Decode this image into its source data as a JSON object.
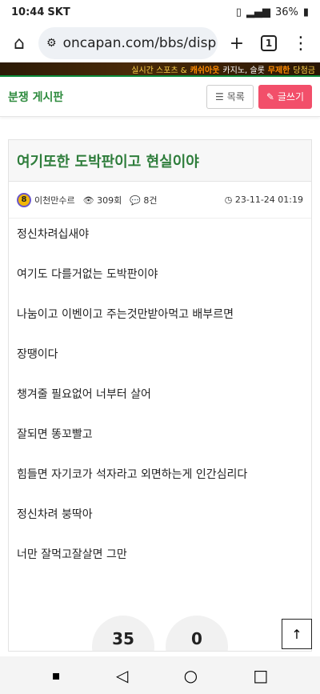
{
  "status": {
    "time": "10:44",
    "carrier": "SKT",
    "battery": "36%"
  },
  "browser": {
    "url": "oncapan.com/bbs/disp",
    "tab_count": "1"
  },
  "banner": {
    "prefix": "실시간 스포츠 &",
    "casino": "캐쉬아웃",
    "middle": "카지노, 슬롯",
    "unlimited": "무제한",
    "suffix": "당첨금"
  },
  "board": {
    "title": "분쟁 게시판",
    "list_label": "목록",
    "write_label": "글쓰기"
  },
  "post": {
    "title": "여기또한 도박판이고 현실이야",
    "author_level": "8",
    "author": "이천만수르",
    "views": "309회",
    "comments": "8건",
    "date": "23-11-24 01:19",
    "lines": [
      "정신차려십새야",
      "여기도 다를거없는 도박판이야",
      "나눔이고 이벤이고 주는것만받아먹고 배부르면",
      "장땡이다",
      "챙겨줄 필요없어 너부터 살어",
      "잘되면 똥꼬빨고",
      "힘들면 자기코가 석자라고 외면하는게 인간심리다",
      "정신차려 붕딱아",
      "너만 잘먹고잘살면 그만"
    ],
    "upvotes": "35",
    "downvotes": "0"
  }
}
